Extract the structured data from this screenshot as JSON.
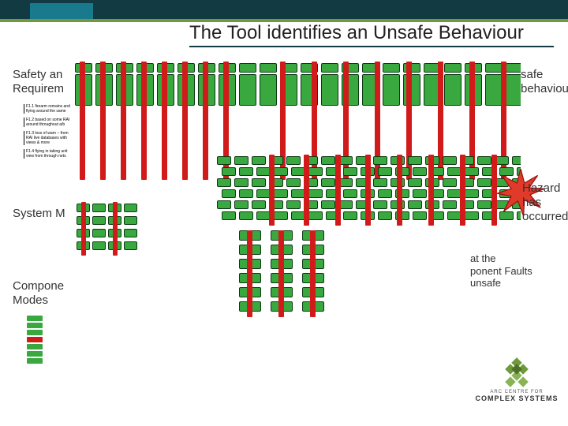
{
  "header": {
    "title": "The Tool identifies an Unsafe Behaviour"
  },
  "left_labels": {
    "safety": "Safety an\nRequirem",
    "system_model": "System M",
    "component_modes": "Compone\nModes"
  },
  "captions": {
    "a": "F1.1 firearm remains and flying around the same",
    "b": "F1.2 based on some RAI around throughout a/b",
    "c": "F1.3 loss of warn – from RAI live databases with views & more",
    "d": "F1.4 flying in taking unit view from through nets"
  },
  "right_callouts": {
    "unsafe": "safe behaviours",
    "hazard_line1": "Hazard has",
    "hazard_line2": "occurred",
    "explain_l1": "at the",
    "explain_l2": "ponent Faults",
    "explain_l3": "unsafe"
  },
  "logo": {
    "line1": "ARC CENTRE FOR",
    "line2": "COMPLEX SYSTEMS"
  },
  "chart_data": {
    "type": "diagram",
    "description": "Hierarchical behaviour-tree / fault-propagation diagram. Three labelled horizontal strata (Safety and Requirements, System Model, Component Modes) left to right filled with many small green process blocks connected by thin lines. Several vertical red bars overlay the green blocks indicating active fault paths propagating downward through the tree. A starburst at the right marks a hazard occurrence.",
    "strata": [
      {
        "name": "Safety and Requirements",
        "approx_blocks": 40
      },
      {
        "name": "System Model",
        "approx_blocks": 120
      },
      {
        "name": "Component Modes",
        "approx_blocks": 30
      }
    ],
    "fault_path_bars": 18,
    "hazard_marker": true
  }
}
